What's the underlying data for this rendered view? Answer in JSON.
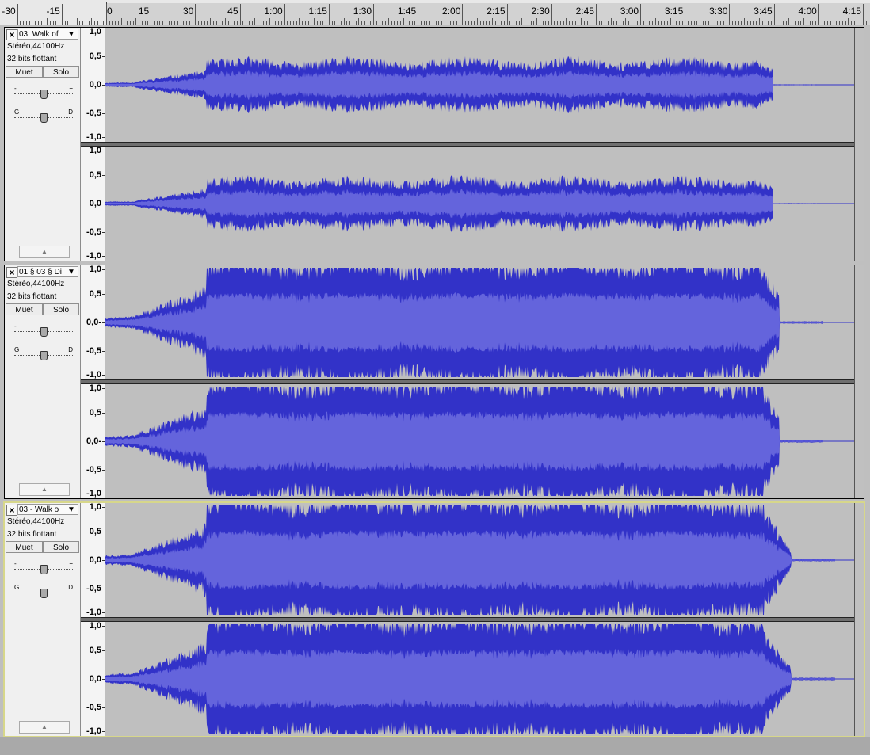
{
  "ruler": {
    "labels": [
      {
        "text": "-30",
        "t": -30
      },
      {
        "text": "-15",
        "t": -15
      },
      {
        "text": "0",
        "t": 0
      },
      {
        "text": "15",
        "t": 15
      },
      {
        "text": "30",
        "t": 30
      },
      {
        "text": "45",
        "t": 45
      },
      {
        "text": "1:00",
        "t": 60
      },
      {
        "text": "1:15",
        "t": 75
      },
      {
        "text": "1:30",
        "t": 90
      },
      {
        "text": "1:45",
        "t": 105
      },
      {
        "text": "2:00",
        "t": 120
      },
      {
        "text": "2:15",
        "t": 135
      },
      {
        "text": "2:30",
        "t": 150
      },
      {
        "text": "2:45",
        "t": 165
      },
      {
        "text": "3:00",
        "t": 180
      },
      {
        "text": "3:15",
        "t": 195
      },
      {
        "text": "3:30",
        "t": 210
      },
      {
        "text": "3:45",
        "t": 225
      },
      {
        "text": "4:00",
        "t": 240
      },
      {
        "text": "4:15",
        "t": 255
      }
    ]
  },
  "tracks": [
    {
      "name": "03. Walk of",
      "info_line1": "Stéréo,44100Hz",
      "info_line2": "32 bits flottant",
      "mute_label": "Muet",
      "solo_label": "Solo",
      "gain_min_label": "-",
      "gain_max_label": "+",
      "pan_left_label": "G",
      "pan_right_label": "D",
      "selected": false,
      "amplitude": 0.42,
      "clip_len": 240,
      "scale_labels": [
        "1,0",
        "0,5",
        "0,0",
        "-0,5",
        "-1,0"
      ]
    },
    {
      "name": "01 § 03 § Di",
      "info_line1": "Stéréo,44100Hz",
      "info_line2": "32 bits flottant",
      "mute_label": "Muet",
      "solo_label": "Solo",
      "gain_min_label": "-",
      "gain_max_label": "+",
      "pan_left_label": "G",
      "pan_right_label": "D",
      "selected": false,
      "amplitude": 1.0,
      "clip_len": 242,
      "scale_labels": [
        "1,0",
        "0,5",
        "0,0-",
        "-0,5",
        "-1,0"
      ]
    },
    {
      "name": "03 - Walk o",
      "info_line1": "Stéréo,44100Hz",
      "info_line2": "32 bits flottant",
      "mute_label": "Muet",
      "solo_label": "Solo",
      "gain_min_label": "-",
      "gain_max_label": "+",
      "pan_left_label": "G",
      "pan_right_label": "D",
      "selected": true,
      "amplitude": 1.0,
      "clip_len": 246,
      "scale_labels": [
        "1,0",
        "0,5",
        "0,0",
        "-0,5",
        "-1,0"
      ]
    }
  ],
  "colors": {
    "wave_peak": "#3232c8",
    "wave_rms": "#6464dc",
    "selected_border": "#d7d78a"
  },
  "icons": {
    "close": "close-icon",
    "menu": "dropdown-arrow-icon",
    "collapse": "collapse-arrow-icon"
  }
}
